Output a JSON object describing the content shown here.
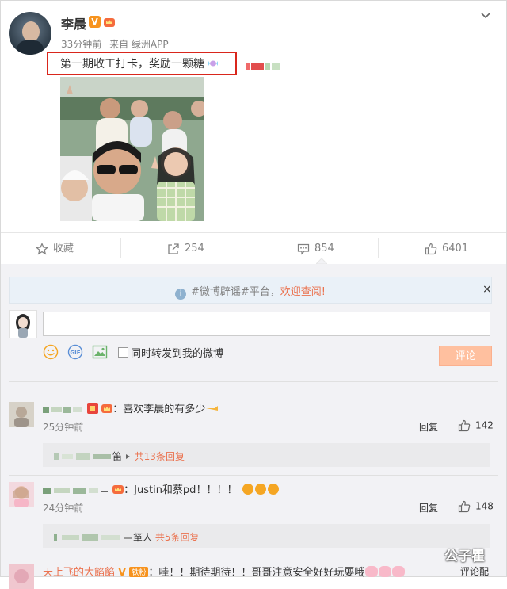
{
  "post": {
    "username": "李晨",
    "time": "33分钟前",
    "source": "来自 绿洲APP",
    "text": "第一期收工打卡，奖励一颗糖",
    "v_badge": "V"
  },
  "actions": {
    "favorite": "收藏",
    "repost_count": "254",
    "comment_count": "854",
    "like_count": "6401"
  },
  "notice": {
    "prefix": "#微博辟谣#平台，",
    "link": "欢迎查阅!",
    "close": "×"
  },
  "composer": {
    "checkbox_label": "同时转发到我的微博",
    "submit": "评论"
  },
  "comments": [
    {
      "text": "：喜欢李晨的有多少",
      "time": "25分钟前",
      "reply": "回复",
      "likes": "142",
      "sub_author_suffix": "笛",
      "sub_count": "共13条回复"
    },
    {
      "text": "：Justin和蔡pd！！！！",
      "time": "24分钟前",
      "reply": "回复",
      "likes": "148",
      "sub_author_suffix": "箪人",
      "sub_count": "共5条回复"
    },
    {
      "name": "天上飞的大餡餡",
      "badge_v": "V",
      "badge_fans": "铁粉",
      "text": "：哇！！期待期待！！哥哥注意安全好好玩耍哦",
      "reply_partial": "评论配"
    }
  ],
  "watermark": "公子瞿",
  "colors": {
    "accent": "#eb7350",
    "submit_bg": "#ffc09f",
    "highlight_border": "#d9261c",
    "badge_orange": "#f7931e"
  }
}
